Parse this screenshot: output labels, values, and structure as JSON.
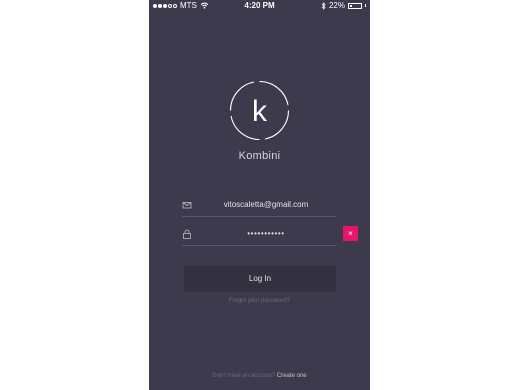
{
  "status_bar": {
    "carrier": "MTS",
    "time": "4:20 PM",
    "battery": "22%",
    "battery_level": 0.22,
    "signal_bars_filled": 3,
    "signal_bars_total": 5
  },
  "app": {
    "logo_letter": "k",
    "name": "Kombini"
  },
  "login_form": {
    "email_value": "vitoscaletta@gmail.com",
    "email_icon": "mail-icon",
    "password_value": "•••••••••••",
    "password_icon": "lock-icon",
    "clear_label": "×",
    "login_label": "Log In",
    "forgot_password": "Forgot your password?",
    "signup_prompt": "Don't have an account?",
    "signup_link": "Create one"
  },
  "colors": {
    "background": "#3c3a4c",
    "accent": "#e8166b",
    "button": "#33313f",
    "text": "#e4e2ee",
    "muted": "#6c6a80"
  }
}
